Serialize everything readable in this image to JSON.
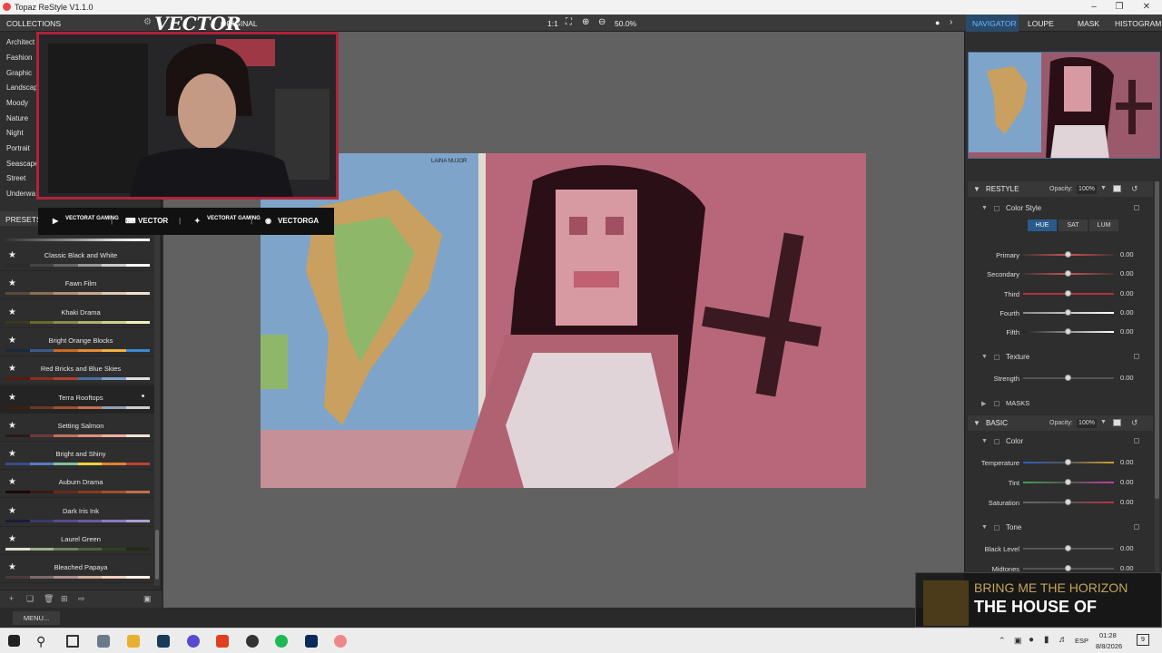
{
  "app": {
    "title": "Topaz ReStyle V1.1.0"
  },
  "topbar": {
    "collections_label": "COLLECTIONS",
    "original_label": "ORIGINAL",
    "zoom_1to1": "1:1",
    "zoom_level": "50.0%",
    "tabs": [
      "NAVIGATOR",
      "LOUPE",
      "MASK",
      "HISTOGRAM"
    ]
  },
  "collections": [
    "Architect",
    "Fashion",
    "Graphic",
    "Landscap",
    "Moody",
    "Nature",
    "Night",
    "Portrait",
    "Seascape",
    "Street",
    "Underwa"
  ],
  "presets_label": "PRESETS",
  "presets": [
    {
      "name": "Classic Black and White",
      "colors": [
        "#2a2a2a",
        "#444",
        "#666",
        "#999",
        "#ccc",
        "#fff"
      ],
      "selected": false
    },
    {
      "name": "Fawn Film",
      "colors": [
        "#5a4a3a",
        "#8a7050",
        "#b09070",
        "#c8a888",
        "#e0c8b0",
        "#f0e0d0"
      ],
      "selected": false
    },
    {
      "name": "Khaki Drama",
      "colors": [
        "#3a3a20",
        "#6a6a30",
        "#8a8a50",
        "#b0b070",
        "#d0d090",
        "#f0f0c0"
      ],
      "selected": false
    },
    {
      "name": "Bright Orange Blocks",
      "colors": [
        "#1a2a3a",
        "#3a5a8a",
        "#c86a20",
        "#e88a30",
        "#f0b040",
        "#3a8ad0"
      ],
      "selected": false
    },
    {
      "name": "Red Bricks and Blue Skies",
      "colors": [
        "#5a1a10",
        "#8a3020",
        "#b04030",
        "#4a70a0",
        "#80a0c8",
        "#e0e0e0"
      ],
      "selected": false
    },
    {
      "name": "Terra Rooftops",
      "colors": [
        "#3a2010",
        "#6a3a20",
        "#a05030",
        "#c07050",
        "#90a0b0",
        "#d0d0d0"
      ],
      "selected": true
    },
    {
      "name": "Setting Salmon",
      "colors": [
        "#2a1a1a",
        "#6a3a3a",
        "#c07060",
        "#e09080",
        "#f0b0a0",
        "#ffe0d0"
      ],
      "selected": false
    },
    {
      "name": "Bright and Shiny",
      "colors": [
        "#3a4a8a",
        "#5a7ac0",
        "#80c0a0",
        "#f0d040",
        "#e08030",
        "#c04030"
      ],
      "selected": false
    },
    {
      "name": "Auburn Drama",
      "colors": [
        "#1a0a0a",
        "#3a1a10",
        "#6a2a20",
        "#8a3a20",
        "#a05030",
        "#c07050"
      ],
      "selected": false
    },
    {
      "name": "Dark Iris Ink",
      "colors": [
        "#1a1a3a",
        "#3a3a6a",
        "#5a4a8a",
        "#6a5aa0",
        "#8a7ac0",
        "#b0a0d0"
      ],
      "selected": false
    },
    {
      "name": "Laurel Green",
      "colors": [
        "#e0e0d0",
        "#a0b090",
        "#708060",
        "#506040",
        "#304020",
        "#202a10"
      ],
      "selected": false
    },
    {
      "name": "Bleached Papaya",
      "colors": [
        "#4a3a3a",
        "#7a6a6a",
        "#b09090",
        "#d0b0a0",
        "#f0d0c0",
        "#fff0e8"
      ],
      "selected": false
    }
  ],
  "restyle": {
    "title": "RESTYLE",
    "opacity_label": "Opacity:",
    "opacity_value": "100%",
    "color_style_label": "Color Style",
    "tabs": [
      "HUE",
      "SAT",
      "LUM"
    ],
    "sliders": [
      {
        "label": "Primary",
        "value": "0.00"
      },
      {
        "label": "Secondary",
        "value": "0.00"
      },
      {
        "label": "Third",
        "value": "0.00"
      },
      {
        "label": "Fourth",
        "value": "0.00"
      },
      {
        "label": "Fifth",
        "value": "0.00"
      }
    ],
    "texture_label": "Texture",
    "strength": {
      "label": "Strength",
      "value": "0.00"
    },
    "masks_label": "MASKS"
  },
  "basic": {
    "title": "BASIC",
    "opacity_label": "Opacity:",
    "opacity_value": "100%",
    "color_label": "Color",
    "color_sliders": [
      {
        "label": "Temperature",
        "value": "0.00"
      },
      {
        "label": "Tint",
        "value": "0.00"
      },
      {
        "label": "Saturation",
        "value": "0.00"
      }
    ],
    "tone_label": "Tone",
    "tone_sliders": [
      {
        "label": "Black Level",
        "value": "0.00"
      },
      {
        "label": "Midtones",
        "value": "0.00"
      }
    ]
  },
  "menu_button": "MENU...",
  "overlay": {
    "logo": "VECTOR",
    "social": [
      "VECTORAT GAMING",
      "VECTOR",
      "VECTORAT GAMING",
      "VECTORGA"
    ],
    "now_playing_artist": "BRING ME THE HORIZON",
    "now_playing_song": "THE HOUSE OF"
  },
  "photo_labels": {
    "map_title": "LAINA NUJOR"
  },
  "taskbar": {
    "lang": "ESP",
    "time": "01:28",
    "date": "8/8/2026",
    "notif_count": "9"
  }
}
